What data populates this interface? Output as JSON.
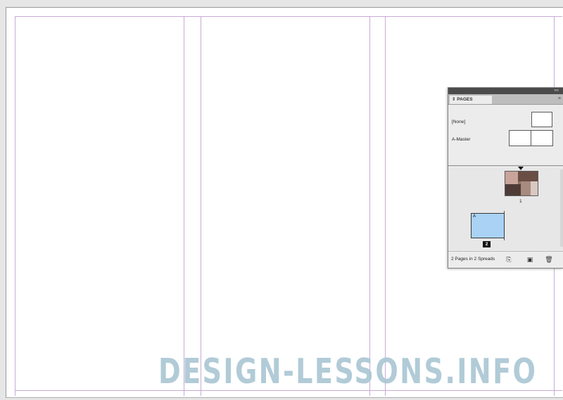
{
  "watermark": "DESIGN-LESSONS.INFO",
  "pages_panel": {
    "tab_label": "PAGES",
    "collapse_label": "««",
    "menu_label": "≡",
    "masters": [
      {
        "label": "[None]"
      },
      {
        "label": "A-Master"
      }
    ],
    "pages": [
      {
        "number": "1",
        "master_prefix": ""
      },
      {
        "number": "2",
        "master_prefix": "A"
      }
    ],
    "status_text": "2 Pages in 2 Spreads",
    "buttons": [
      {
        "name": "page-size-button",
        "icon": "page-size-icon"
      },
      {
        "name": "new-page-button",
        "icon": "new-page-icon"
      },
      {
        "name": "delete-page-button",
        "icon": "trash-icon"
      }
    ]
  },
  "colors": {
    "guide": "#c9a9d6",
    "selected_page": "#a9d2f5",
    "watermark": "#a9c6d3"
  }
}
